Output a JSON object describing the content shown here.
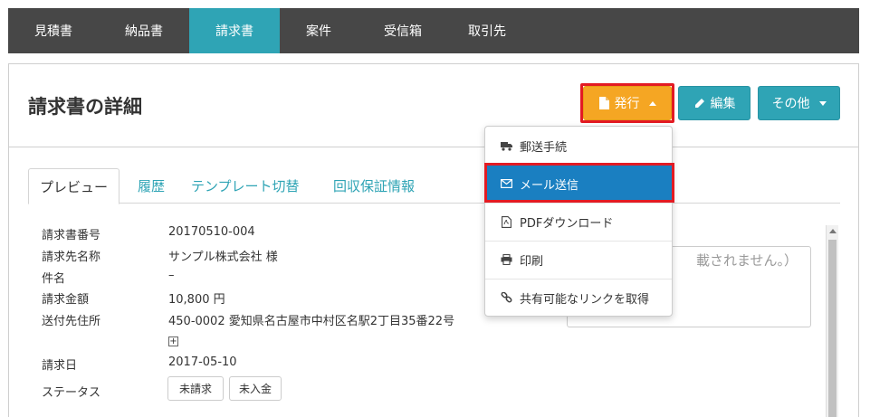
{
  "nav": {
    "tabs": [
      {
        "label": "見積書"
      },
      {
        "label": "納品書"
      },
      {
        "label": "請求書"
      },
      {
        "label": "案件"
      },
      {
        "label": "受信箱"
      },
      {
        "label": "取引先"
      }
    ],
    "active_index": 2
  },
  "header": {
    "title": "請求書の詳細",
    "issue_button": "発行",
    "edit_button": "編集",
    "other_button": "その他"
  },
  "tabs": {
    "items": [
      {
        "label": "プレビュー"
      },
      {
        "label": "履歴"
      },
      {
        "label": "テンプレート切替"
      },
      {
        "label": "回収保証情報"
      }
    ]
  },
  "details": {
    "invoice_number_label": "請求書番号",
    "invoice_number": "20170510-004",
    "client_label": "請求先名称",
    "client": "サンプル株式会社 様",
    "subject_label": "件名",
    "subject": "–",
    "amount_label": "請求金額",
    "amount": "10,800 円",
    "address_label": "送付先住所",
    "address": "450-0002 愛知県名古屋市中村区名駅2丁目35番22号",
    "date_label": "請求日",
    "date": "2017-05-10",
    "status_label": "ステータス",
    "status_badges": [
      "未請求",
      "未入金"
    ]
  },
  "note": {
    "text": "載されません。）"
  },
  "dropdown": {
    "items": [
      {
        "label": "郵送手続",
        "icon": "truck-icon"
      },
      {
        "label": "メール送信",
        "icon": "envelope-icon"
      },
      {
        "label": "PDFダウンロード",
        "icon": "pdf-file-icon"
      },
      {
        "label": "印刷",
        "icon": "printer-icon"
      },
      {
        "label": "共有可能なリンクを取得",
        "icon": "link-icon"
      }
    ],
    "selected_index": 1
  },
  "colors": {
    "nav_bg": "#474747",
    "accent_teal": "#2fa4b5",
    "issue_orange": "#f5a623",
    "highlight_red": "#e31b23",
    "selected_blue": "#1a7fc1"
  }
}
